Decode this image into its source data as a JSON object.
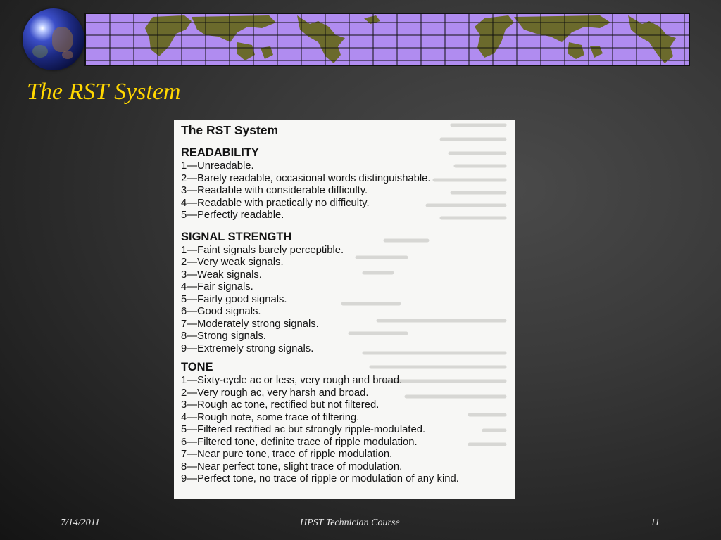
{
  "slide": {
    "title": "The RST System",
    "footer": {
      "date": "7/14/2011",
      "course": "HPST Technician Course",
      "page": "11"
    }
  },
  "colors": {
    "title": "#ffd700",
    "banner_grid": "#b08cf0",
    "land": "#6b6a2c",
    "background": "#3a3a3a"
  },
  "document": {
    "title": "The RST System",
    "sections": [
      {
        "heading": "READABILITY",
        "items": [
          "1—Unreadable.",
          "2—Barely readable, occasional words distinguishable.",
          "3—Readable with considerable difficulty.",
          "4—Readable with practically no difficulty.",
          "5—Perfectly readable."
        ]
      },
      {
        "heading": "SIGNAL STRENGTH",
        "items": [
          "1—Faint signals barely perceptible.",
          "2—Very weak signals.",
          "3—Weak signals.",
          "4—Fair signals.",
          "5—Fairly good signals.",
          "6—Good signals.",
          "7—Moderately strong signals.",
          "8—Strong signals.",
          "9—Extremely strong signals."
        ]
      },
      {
        "heading": "TONE",
        "items": [
          "1—Sixty-cycle ac or less, very rough and broad.",
          "2—Very rough ac, very harsh and broad.",
          "3—Rough ac tone, rectified but not filtered.",
          "4—Rough note, some trace of filtering.",
          "5—Filtered rectified ac but strongly ripple-modulated.",
          "6—Filtered tone, definite trace of ripple modulation.",
          "7—Near pure tone, trace of ripple modulation.",
          "8—Near perfect tone, slight trace of modulation.",
          "9—Perfect tone, no trace of ripple or modulation of any kind."
        ]
      }
    ]
  }
}
